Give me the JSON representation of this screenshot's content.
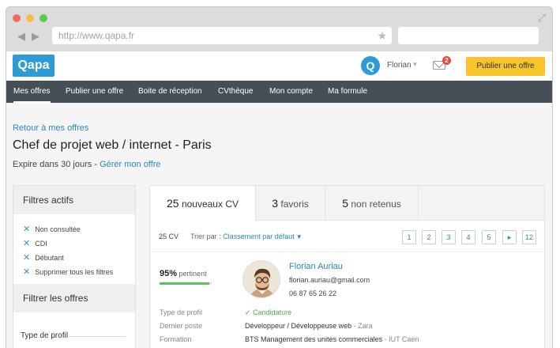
{
  "browser": {
    "url": "http://www.qapa.fr"
  },
  "header": {
    "logo": "Qapa",
    "avatar_letter": "Q",
    "user_name": "Florian",
    "notifications_count": "2",
    "publish_label": "Publier une offre"
  },
  "nav": {
    "items": [
      {
        "label": "Mes offres"
      },
      {
        "label": "Publier une offre"
      },
      {
        "label": "Boite de réception"
      },
      {
        "label": "CVthèque"
      },
      {
        "label": "Mon compte"
      },
      {
        "label": "Ma formule"
      }
    ]
  },
  "page": {
    "back_link": "Retour à mes offres",
    "title": "Chef de projet web / internet - Paris",
    "expire_text": "Expire dans 30 jours",
    "separator": " - ",
    "manage_link": "Gérer mon offre"
  },
  "sidebar": {
    "active_filters_title": "Filtres actifs",
    "active_filters": [
      "Non consultée",
      "CDI",
      "Débutant",
      "Supprimer tous les filtres"
    ],
    "filter_title": "Filtrer les offres",
    "profile_type_label": "Type de profil"
  },
  "results": {
    "tabs": [
      {
        "count": "25",
        "label": "nouveaux CV"
      },
      {
        "count": "3",
        "label": "favoris"
      },
      {
        "count": "5",
        "label": "non retenus"
      }
    ],
    "cv_count": "25 CV",
    "sort_label": "Trier par :",
    "sort_value": "Classement par défaut",
    "pages": [
      "1",
      "2",
      "3",
      "4",
      "5",
      "▸",
      "12"
    ]
  },
  "candidate": {
    "match_percent": "95%",
    "match_label": "pertinent",
    "match_value": 0.95,
    "name": "Florian Auriau",
    "email": "florian.auriau@gmail.com",
    "phone": "06 87 65 26 22",
    "details": [
      {
        "label": "Type de profil",
        "value": "Candidature",
        "sub": ""
      },
      {
        "label": "Dernier poste",
        "value": "Développeur / Développeuse web",
        "sub": "- Zara"
      },
      {
        "label": "Formation",
        "value": "BTS Management des unites commerciales",
        "sub": "- IUT Caen"
      }
    ]
  },
  "colors": {
    "brand": "#2e9ad6",
    "cta": "#f6c42b",
    "nav_bg": "#464e56",
    "link": "#2e86c6",
    "success": "#5cc05c"
  }
}
